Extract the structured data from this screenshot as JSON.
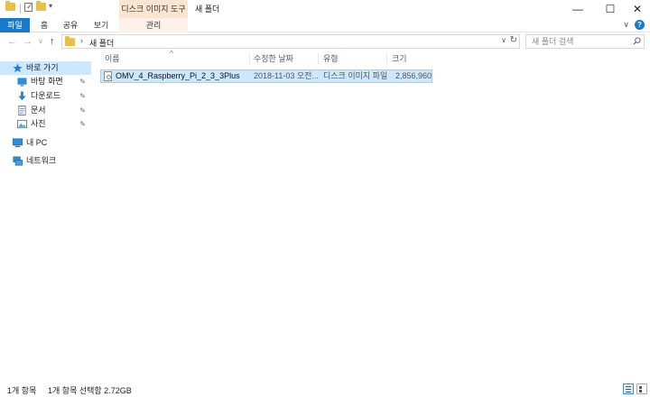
{
  "window": {
    "title": "새 폴더",
    "contextual_tab_group": "디스크 이미지 도구",
    "minimize": "—",
    "maximize": "☐",
    "close": "✕"
  },
  "ribbon": {
    "tabs": [
      {
        "label": "파일",
        "active": true
      },
      {
        "label": "홈"
      },
      {
        "label": "공유"
      },
      {
        "label": "보기"
      },
      {
        "label": "관리"
      }
    ],
    "expand_icon": "chevron-down-icon",
    "help_icon": "help-icon"
  },
  "address": {
    "back": "←",
    "forward": "→",
    "recent": "∨",
    "up": "↑",
    "separator": "›",
    "crumb": "새 폴더",
    "refresh": "↻"
  },
  "search": {
    "placeholder": "새 폴더 검색"
  },
  "nav": {
    "items": [
      {
        "label": "바로 가기",
        "icon": "star-icon"
      },
      {
        "label": "바탕 화면",
        "icon": "desktop-icon",
        "pinned": true
      },
      {
        "label": "다운로드",
        "icon": "download-icon",
        "pinned": true
      },
      {
        "label": "문서",
        "icon": "document-icon",
        "pinned": true
      },
      {
        "label": "사진",
        "icon": "pictures-icon",
        "pinned": true
      },
      {
        "label": "내 PC",
        "icon": "computer-icon"
      },
      {
        "label": "네트워크",
        "icon": "network-icon"
      }
    ],
    "pin_glyph": "📌"
  },
  "columns": {
    "name": "이름",
    "date": "수정한 날짜",
    "type": "유형",
    "size": "크기"
  },
  "files": [
    {
      "name": "OMV_4_Raspberry_Pi_2_3_3Plus",
      "date": "2018-11-03 오전...",
      "type": "디스크 이미지 파일",
      "size": "2,856,960"
    }
  ],
  "status": {
    "count": "1개 항목",
    "selected": "1개 항목 선택함 2.72GB"
  },
  "colors": {
    "accent": "#1979ca",
    "selection": "#cce8ff",
    "context_tab": "#fbe4d0",
    "folder": "#e8bf48"
  }
}
